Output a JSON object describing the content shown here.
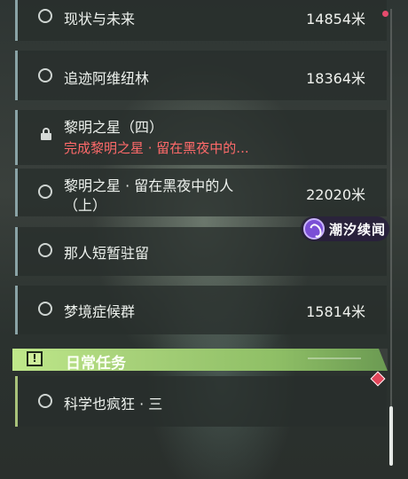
{
  "quests": [
    {
      "name": "现状与未来",
      "distance": "14854米",
      "icon": "radio-icon"
    },
    {
      "name": "追迹阿维纽林",
      "distance": "18364米",
      "icon": "radio-icon"
    },
    {
      "name": "黎明之星（四）",
      "subtitle": "完成黎明之星 · 留在黑夜中的...",
      "icon": "lock-icon"
    },
    {
      "name_line1": "黎明之星 · 留在黑夜中的人",
      "name_line2": "（上）",
      "distance": "22020米",
      "icon": "radio-icon"
    },
    {
      "name": "那人短暂驻留",
      "icon": "radio-icon"
    },
    {
      "name": "梦境症候群",
      "distance": "15814米",
      "icon": "radio-icon"
    }
  ],
  "daily": {
    "title": "日常任务",
    "icon": "exclamation-icon",
    "quests": [
      {
        "name": "科学也疯狂 · 三",
        "icon": "radio-icon"
      }
    ]
  },
  "watermark": {
    "text": "潮汐续闻",
    "icon": "tide-logo-icon"
  },
  "colors": {
    "panel_bg": "#282e2c",
    "accent_border": "#8aa3a6",
    "daily_header": "#bfe88a",
    "warning_text": "#ff6a6a",
    "notification": "#e64b6d"
  }
}
